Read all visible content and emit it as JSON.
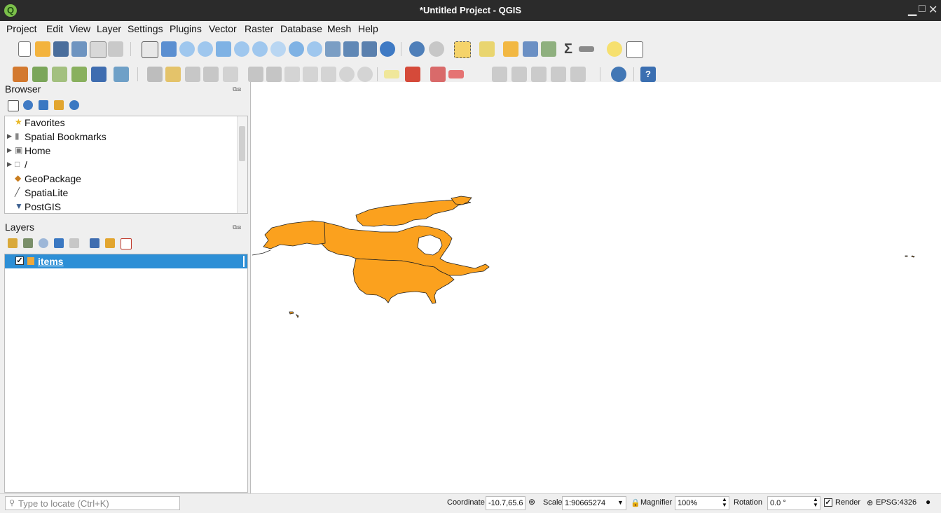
{
  "window": {
    "title": "*Untitled Project - QGIS",
    "logo_letter": "Q"
  },
  "menu": [
    "Project",
    "Edit",
    "View",
    "Layer",
    "Settings",
    "Plugins",
    "Vector",
    "Raster",
    "Database",
    "Mesh",
    "Help"
  ],
  "browser": {
    "title": "Browser",
    "items": [
      {
        "label": "Favorites",
        "icon": "star-icon"
      },
      {
        "label": "Spatial Bookmarks",
        "icon": "bookmark-icon"
      },
      {
        "label": "Home",
        "icon": "home-folder-icon"
      },
      {
        "label": "/",
        "icon": "folder-icon"
      },
      {
        "label": "GeoPackage",
        "icon": "geopackage-icon"
      },
      {
        "label": "SpatiaLite",
        "icon": "spatialite-icon"
      },
      {
        "label": "PostGIS",
        "icon": "postgis-icon"
      }
    ]
  },
  "layers": {
    "title": "Layers",
    "items": [
      {
        "label": "items",
        "checked": true,
        "color": "#f0a93a"
      }
    ]
  },
  "map": {
    "fill_color": "#fba11e",
    "stroke_color": "#222222"
  },
  "status": {
    "locator_placeholder": "Type to locate (Ctrl+K)",
    "coordinate_label": "Coordinate",
    "coordinate_value": "-10.7,65.6",
    "scale_label": "Scale",
    "scale_value": "1:90665274",
    "magnifier_label": "Magnifier",
    "magnifier_value": "100%",
    "rotation_label": "Rotation",
    "rotation_value": "0.0 °",
    "render_label": "Render",
    "render_checked": true,
    "crs": "EPSG:4326"
  }
}
